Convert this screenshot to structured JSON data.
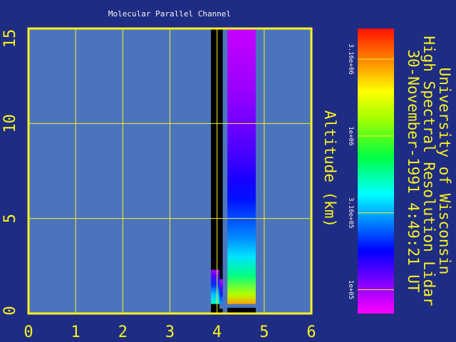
{
  "chart_data": {
    "type": "heatmap",
    "title": "Molecular Parallel Channel",
    "xlabel": "",
    "ylabel": "Altitude (km)",
    "xlim": [
      0,
      6
    ],
    "ylim": [
      0,
      15
    ],
    "x_ticks": [
      "0",
      "1",
      "2",
      "3",
      "4",
      "5",
      "6"
    ],
    "y_ticks": [
      "0",
      "5",
      "10",
      "15"
    ],
    "grid": true,
    "colorbar": {
      "scale": "log",
      "range": [
        70000,
        5000000
      ],
      "tick_values": [
        100000,
        316000,
        1000000,
        3160000
      ],
      "tick_labels": [
        "1e+05",
        "3.16e+05",
        "1e+06",
        "3.16e+06"
      ]
    },
    "header_lines": [
      "University of Wisconsin",
      "High Spectral Resolution Lidar",
      "30-November-1991   4:49:21 UT"
    ],
    "data_segments": [
      {
        "x_range": [
          3.87,
          4.05
        ],
        "profile": [
          {
            "alt": 0.5,
            "value": 500000
          },
          {
            "alt": 1.0,
            "value": 340000
          },
          {
            "alt": 1.5,
            "value": 210000
          },
          {
            "alt": 2.0,
            "value": 130000
          },
          {
            "alt": 2.3,
            "value": 95000
          }
        ],
        "no_data_above": 2.3
      },
      {
        "x_range": [
          4.05,
          4.12
        ],
        "profile": [
          {
            "alt": 0.5,
            "value": 300000
          },
          {
            "alt": 1.0,
            "value": 200000
          },
          {
            "alt": 1.5,
            "value": 120000
          },
          {
            "alt": 1.8,
            "value": 90000
          }
        ],
        "no_data_above": 1.8
      },
      {
        "x_range": [
          4.22,
          4.82
        ],
        "profile": [
          {
            "alt": 0.5,
            "value": 2800000
          },
          {
            "alt": 1.0,
            "value": 1400000
          },
          {
            "alt": 2.0,
            "value": 600000
          },
          {
            "alt": 3.0,
            "value": 380000
          },
          {
            "alt": 4.0,
            "value": 280000
          },
          {
            "alt": 5.0,
            "value": 230000
          },
          {
            "alt": 6.0,
            "value": 190000
          },
          {
            "alt": 7.0,
            "value": 165000
          },
          {
            "alt": 8.0,
            "value": 145000
          },
          {
            "alt": 9.0,
            "value": 130000
          },
          {
            "alt": 10.0,
            "value": 118000
          },
          {
            "alt": 11.0,
            "value": 108000
          },
          {
            "alt": 12.0,
            "value": 100000
          },
          {
            "alt": 13.0,
            "value": 95000
          },
          {
            "alt": 14.0,
            "value": 90000
          },
          {
            "alt": 15.0,
            "value": 86000
          }
        ]
      }
    ],
    "no_data_bands": [
      {
        "x_range": [
          3.87,
          4.05
        ],
        "alt_range": [
          0,
          0.5
        ]
      },
      {
        "x_range": [
          3.87,
          4.05
        ],
        "alt_range": [
          2.3,
          15
        ]
      },
      {
        "x_range": [
          4.05,
          4.12
        ],
        "alt_range": [
          0,
          0.25
        ]
      },
      {
        "x_range": [
          4.05,
          4.12
        ],
        "alt_range": [
          1.8,
          15
        ]
      },
      {
        "x_range": [
          4.22,
          4.82
        ],
        "alt_range": [
          0,
          0.3
        ]
      }
    ]
  },
  "colors": {
    "frame": "#f7f321",
    "grid": "#f7f321",
    "plot_background": "#4c74bd",
    "page_background": "#1f2c83",
    "text": "#f7f321",
    "title_text": "#f5f5f5",
    "no_data": "#000000"
  }
}
